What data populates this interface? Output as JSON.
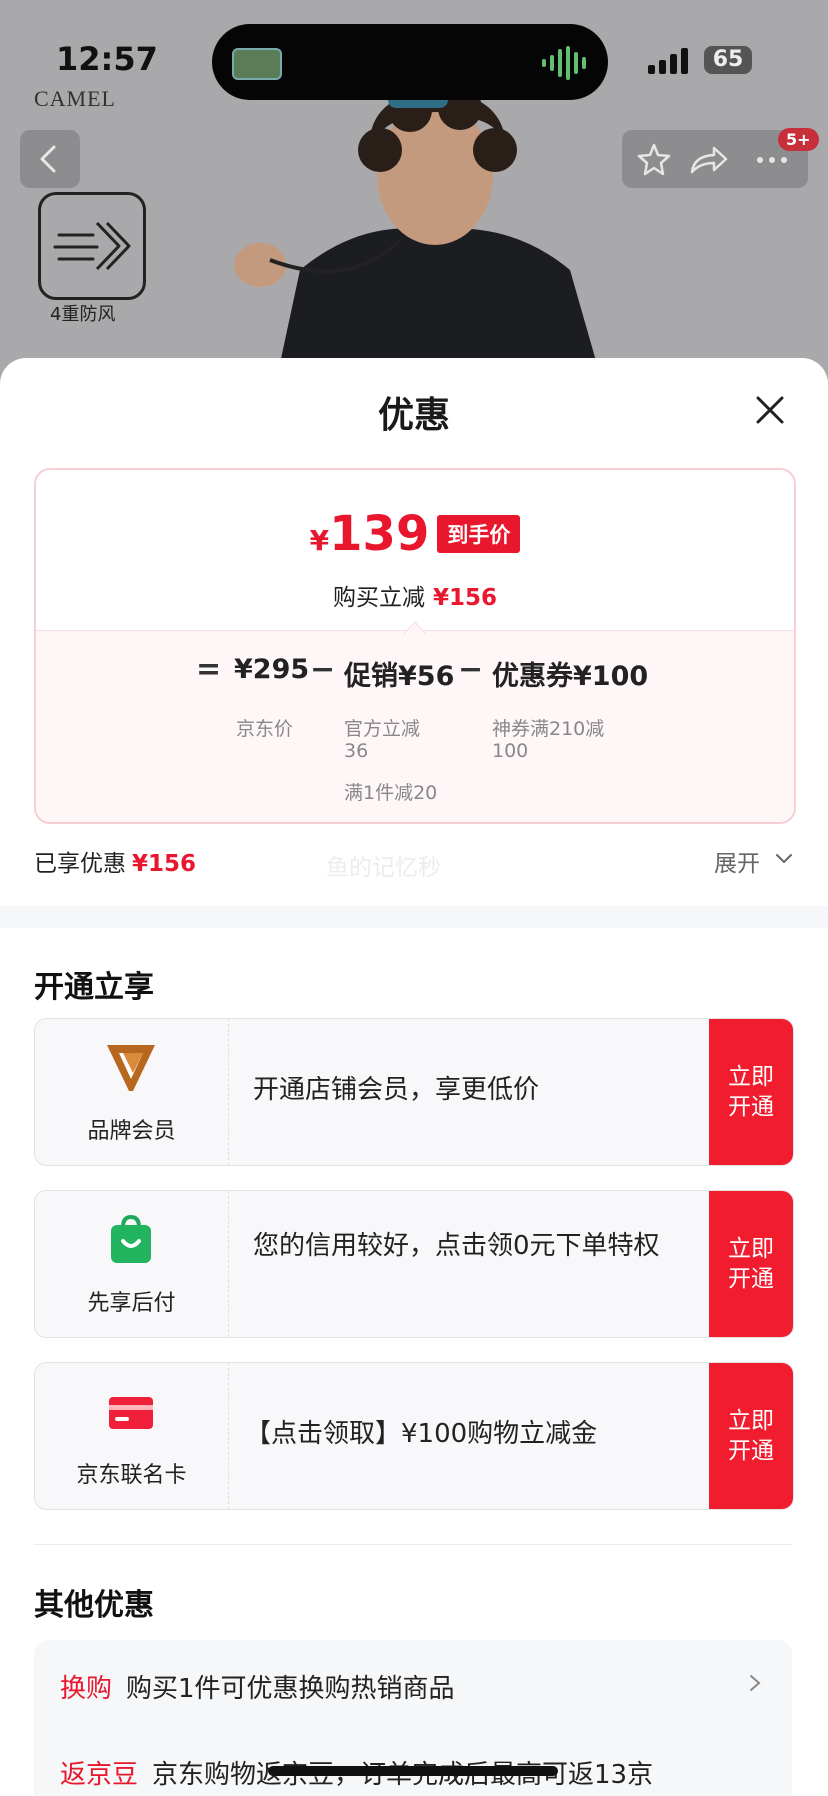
{
  "status_bar": {
    "time": "12:57",
    "battery": "65"
  },
  "background": {
    "brand": "CAMEL",
    "badge": "5+",
    "feature_label": "4重防风"
  },
  "sheet": {
    "title": "优惠",
    "price_card": {
      "currency": "¥",
      "final_price": "139",
      "final_tag": "到手价",
      "reduce_label": "购买立减",
      "reduce_amount": "¥156",
      "formula": {
        "eq": "=",
        "jd_price": "¥295",
        "minus": "−",
        "promo": "促销¥56",
        "coupon": "优惠券¥100"
      },
      "jd_price_label": "京东价",
      "promo_details": [
        "官方立减",
        "36",
        "满1件减20"
      ],
      "coupon_details": [
        "神券满210减",
        "100"
      ]
    },
    "enjoyed": {
      "label": "已享优惠",
      "amount": "¥156"
    },
    "watermark": "鱼的记忆秒",
    "expand_label": "展开",
    "open_section": {
      "title": "开通立享",
      "cards": [
        {
          "label": "品牌会员",
          "desc": "开通店铺会员，享更低价",
          "button": "立即\n开通",
          "icon": "brand-member-v-icon"
        },
        {
          "label": "先享后付",
          "desc": "您的信用较好，点击领0元下单特权",
          "button": "立即\n开通",
          "icon": "shopping-bag-icon"
        },
        {
          "label": "京东联名卡",
          "desc": "【点击领取】¥100购物立减金",
          "button": "立即\n开通",
          "icon": "credit-card-icon"
        }
      ]
    },
    "other_section": {
      "title": "其他优惠",
      "items": [
        {
          "kind": "换购",
          "text": "购买1件可优惠换购热销商品"
        },
        {
          "kind": "返京豆",
          "text": "京东购物返京豆，订单完成后最高可返13京"
        }
      ]
    }
  },
  "colors": {
    "accent": "#e8172d",
    "button": "#f21c2f"
  }
}
